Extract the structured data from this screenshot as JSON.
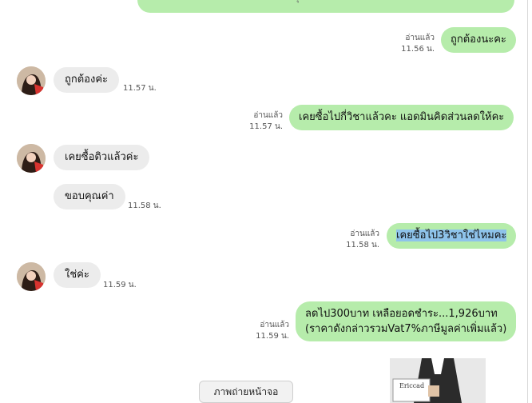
{
  "messages": {
    "top_partial": "ช่วงลดค่าเรียนเล็ดลอดลอยกันไปอุตลงราคา",
    "m1": {
      "text": "ถูกต้องนะคะ",
      "status": "อ่านแล้ว",
      "time": "11.56 น."
    },
    "m2": {
      "text": "ถูกต้องค่ะ",
      "time": "11.57 น."
    },
    "m3": {
      "text": "เคยซื้อไปกี่วิชาแล้วคะ แอดมินคิดส่วนลดให้คะ",
      "status": "อ่านแล้ว",
      "time": "11.57 น."
    },
    "m4": {
      "text": "เคยซื้อติวแล้วค่ะ"
    },
    "m5": {
      "text": "ขอบคุณค่า",
      "time": "11.58 น."
    },
    "m6": {
      "text": "เคยซื้อไป3วิชาใช่ไหมคะ",
      "status": "อ่านแล้ว",
      "time": "11.58 น."
    },
    "m7": {
      "text": "ใช่ค่ะ",
      "time": "11.59 น."
    },
    "m8": {
      "line1": "ลดไป300บาท เหลือยอดชำระ...1,926บาท",
      "line2": "(ราคาดังกล่าวรวมVat7%ภาษีมูลค่าเพิ่มแล้ว)",
      "status": "อ่านแล้ว",
      "time": "11.59 น."
    }
  },
  "image_preview": {
    "card_text": "Ericcad"
  },
  "screenshot_button": {
    "label": "ภาพถ่ายหน้าจอ"
  },
  "colors": {
    "incoming": "#ececec",
    "outgoing": "#b6ecab",
    "highlight": "#8ec3ea"
  }
}
